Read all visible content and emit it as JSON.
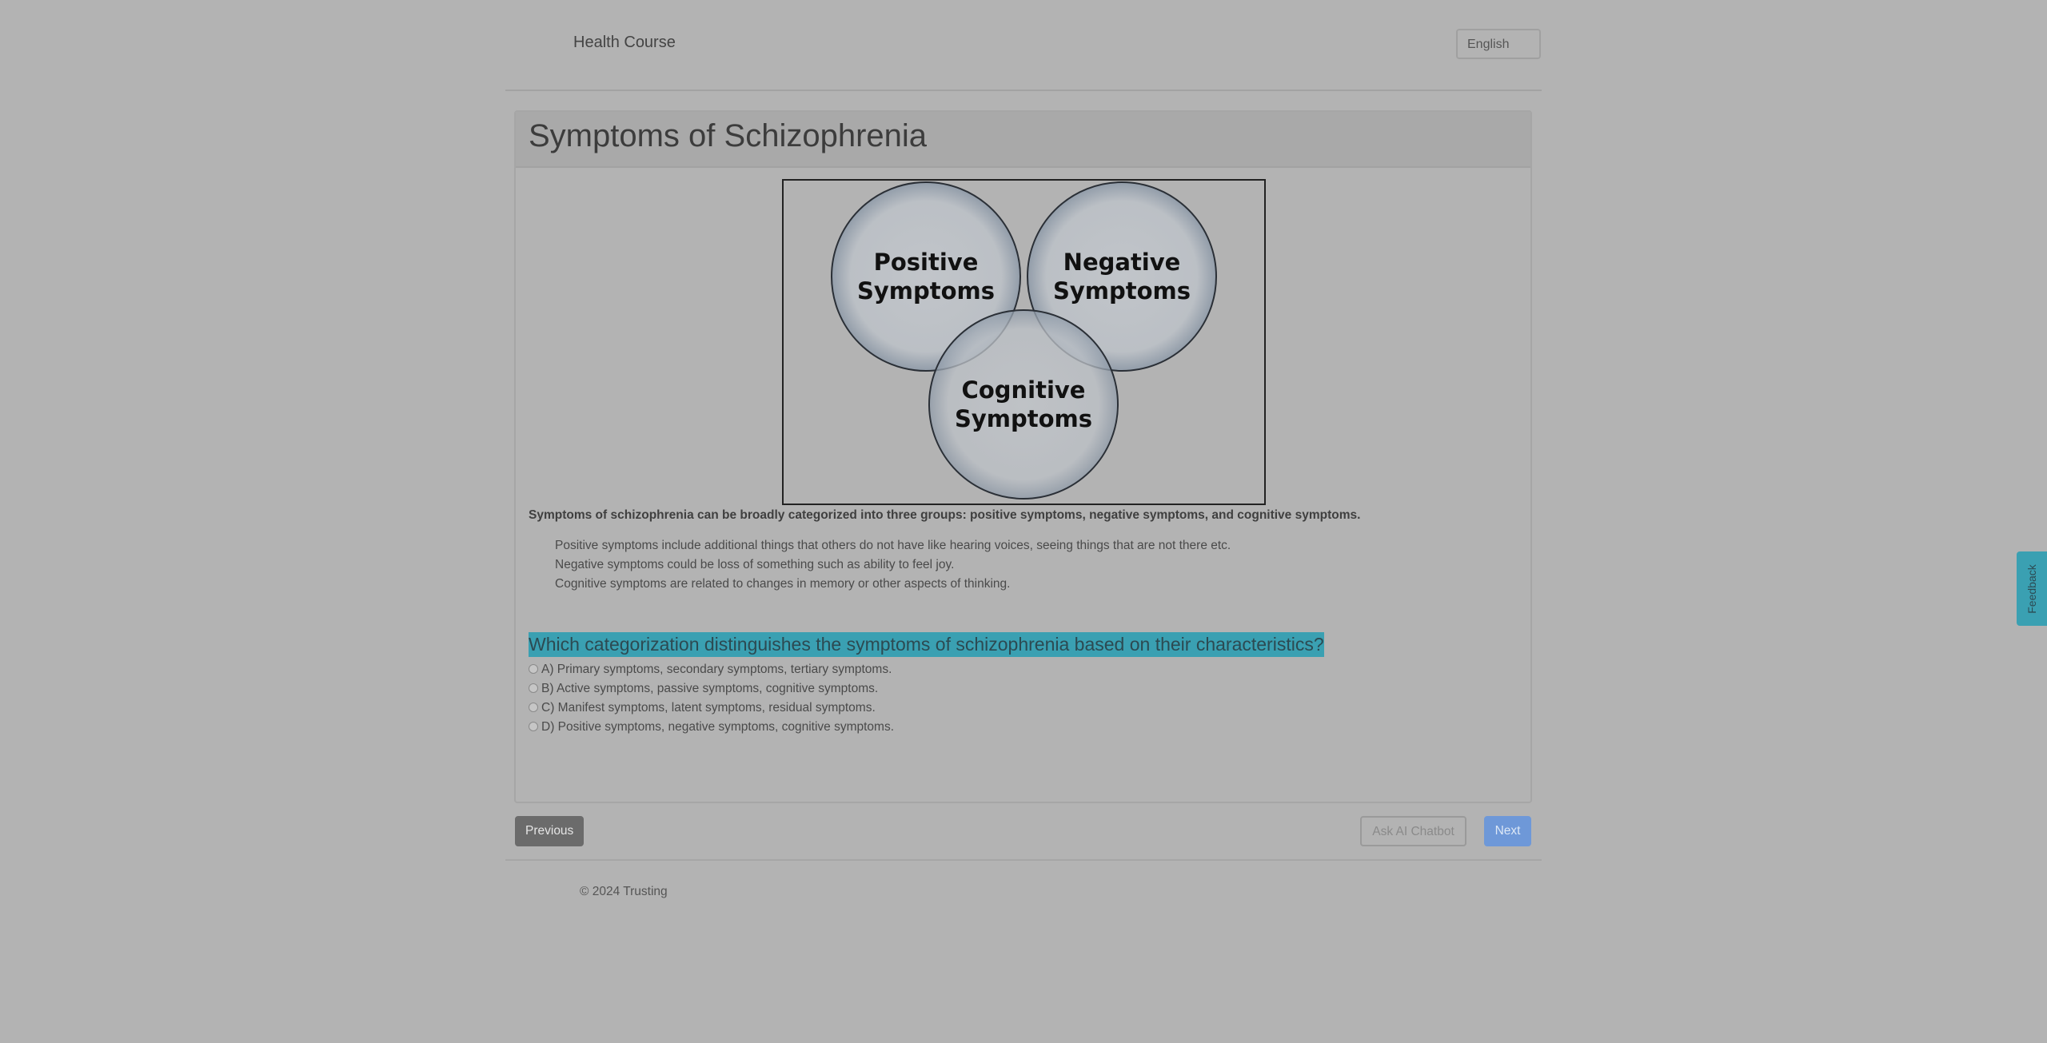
{
  "header": {
    "brand": "Health Course",
    "language": "English"
  },
  "lesson": {
    "title": "Symptoms of Schizophrenia",
    "diagram": {
      "circle_1_line_1": "Positive",
      "circle_1_line_2": "Symptoms",
      "circle_2_line_1": "Negative",
      "circle_2_line_2": "Symptoms",
      "circle_3_line_1": "Cognitive",
      "circle_3_line_2": "Symptoms"
    },
    "summary": "Symptoms of schizophrenia can be broadly categorized into three groups: positive symptoms, negative symptoms, and cognitive symptoms.",
    "details": [
      "Positive symptoms include additional things that others do not have like hearing voices, seeing things that are not there etc.",
      "Negative symptoms could be loss of something such as ability to feel joy.",
      "Cognitive symptoms are related to changes in memory or other aspects of thinking."
    ]
  },
  "quiz": {
    "question": "Which categorization distinguishes the symptoms of schizophrenia based on their characteristics?",
    "options": [
      "A) Primary symptoms, secondary symptoms, tertiary symptoms.",
      "B) Active symptoms, passive symptoms, cognitive symptoms.",
      "C) Manifest symptoms, latent symptoms, residual symptoms.",
      "D) Positive symptoms, negative symptoms, cognitive symptoms."
    ]
  },
  "nav": {
    "previous": "Previous",
    "ask_chatbot": "Ask AI Chatbot",
    "next": "Next"
  },
  "footer": {
    "copyright": "© 2024 Trusting"
  },
  "feedback": {
    "label": "Feedback"
  },
  "colors": {
    "overlay_bg": "#b3b3b3",
    "highlight": "#3aa0b2",
    "next_button": "#6e98d8"
  }
}
